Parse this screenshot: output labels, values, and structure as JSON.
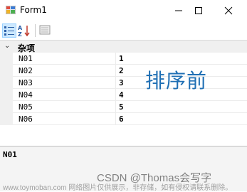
{
  "window": {
    "title": "Form1"
  },
  "toolbar": {
    "categorized_icon": "categorized-view-icon",
    "alphabetical_icon": "alphabetical-sort-icon",
    "property_pages_icon": "property-pages-icon"
  },
  "grid": {
    "category": "杂项",
    "properties": [
      {
        "name": "N01",
        "value": "1"
      },
      {
        "name": "N02",
        "value": "2"
      },
      {
        "name": "N03",
        "value": "3"
      },
      {
        "name": "N04",
        "value": "4"
      },
      {
        "name": "N05",
        "value": "5"
      },
      {
        "name": "N06",
        "value": "6"
      }
    ],
    "selected": "N01"
  },
  "overlay_text": "排序前",
  "help": {
    "title": "N01"
  },
  "watermarks": {
    "csdn": "CSDN @Thomas会写字",
    "site": "www.toymoban.com 网络图片仅供展示，非存储，如有侵权请联系删除。"
  },
  "colors": {
    "accent": "#1f6fb4",
    "selection": "#cce8ff"
  }
}
